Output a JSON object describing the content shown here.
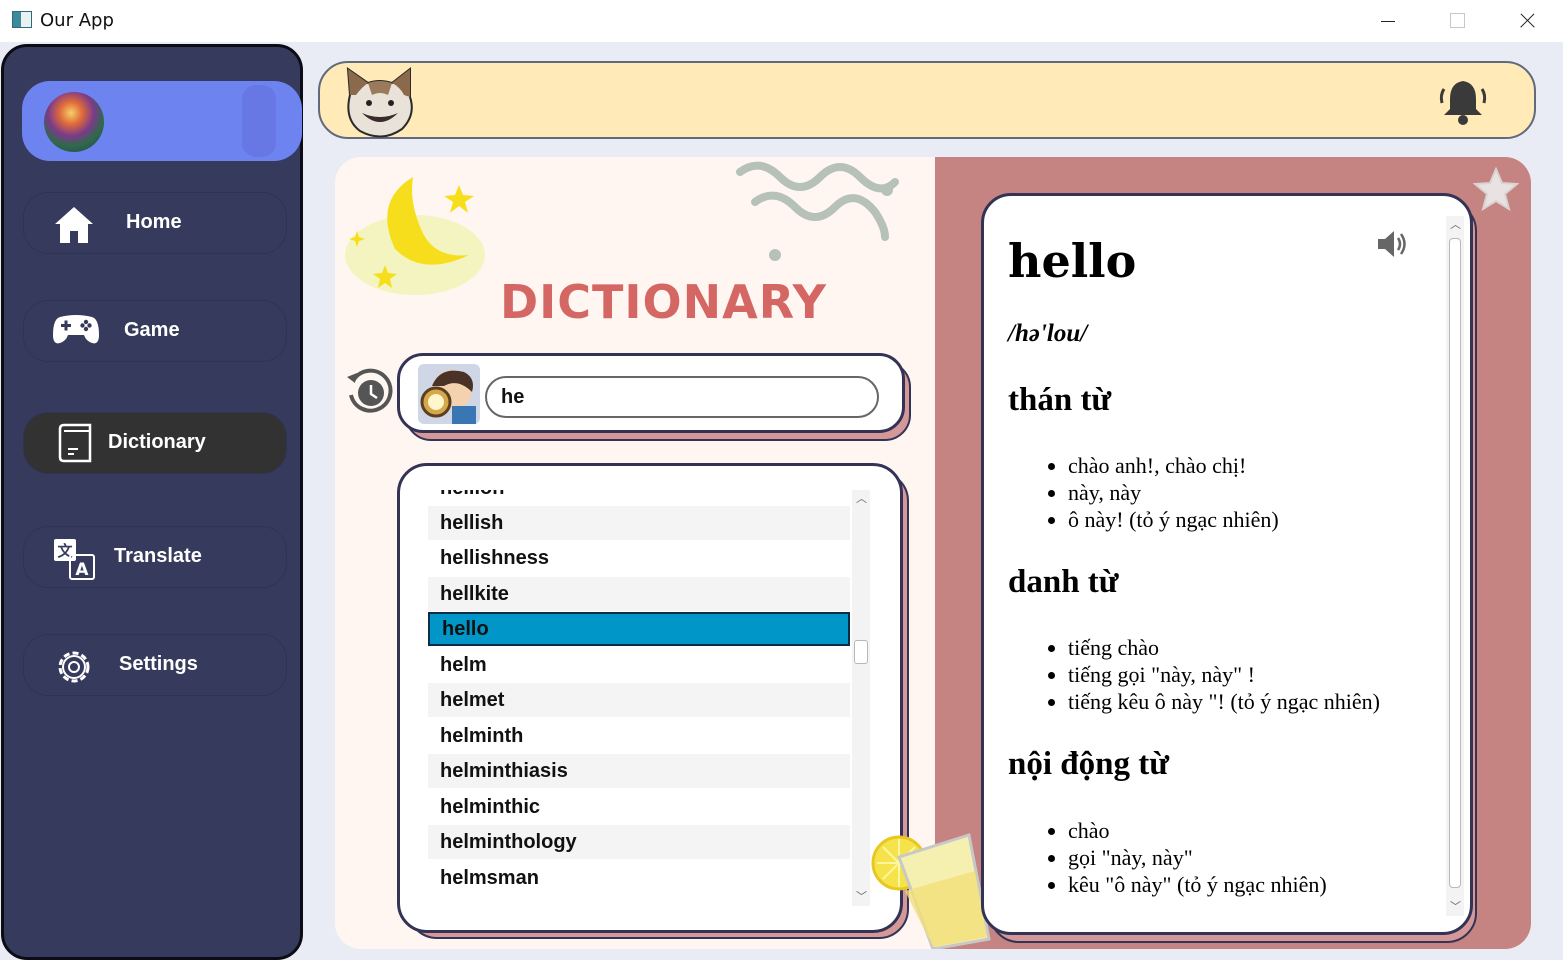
{
  "window": {
    "title": "Our App"
  },
  "sidebar": {
    "items": [
      {
        "label": "Home",
        "icon": "home-icon"
      },
      {
        "label": "Game",
        "icon": "gamepad-icon"
      },
      {
        "label": "Dictionary",
        "icon": "book-icon",
        "active": true
      },
      {
        "label": "Translate",
        "icon": "translate-icon"
      },
      {
        "label": "Settings",
        "icon": "gear-icon"
      }
    ]
  },
  "dictionary": {
    "title": "DICTIONARY",
    "search": {
      "value": "he"
    },
    "results": [
      {
        "word": "hellion"
      },
      {
        "word": "hellish"
      },
      {
        "word": "hellishness"
      },
      {
        "word": "hellkite"
      },
      {
        "word": "hello",
        "selected": true
      },
      {
        "word": "helm"
      },
      {
        "word": "helmet"
      },
      {
        "word": "helminth"
      },
      {
        "word": "helminthiasis"
      },
      {
        "word": "helminthic"
      },
      {
        "word": "helminthology"
      },
      {
        "word": "helmsman"
      }
    ]
  },
  "definition": {
    "word": "hello",
    "ipa": "/hə'lou/",
    "sections": [
      {
        "pos": "thán từ",
        "meanings": [
          "chào anh!, chào chị!",
          "này, này",
          "ô này! (tỏ ý ngạc nhiên)"
        ]
      },
      {
        "pos": "danh từ",
        "meanings": [
          "tiếng chào",
          "tiếng gọi \"này, này\" !",
          "tiếng kêu ô này \"! (tỏ ý ngạc nhiên)"
        ]
      },
      {
        "pos": "nội động từ",
        "meanings": [
          "chào",
          "gọi \"này, này\"",
          "kêu \"ô này\" (tỏ ý ngạc nhiên)"
        ]
      }
    ]
  },
  "colors": {
    "sidebar": "#363a5c",
    "profile": "#6d83f0",
    "topbar": "#ffeab8",
    "accent": "#d46764",
    "selected": "#0096c8",
    "panel": "#c58482"
  }
}
